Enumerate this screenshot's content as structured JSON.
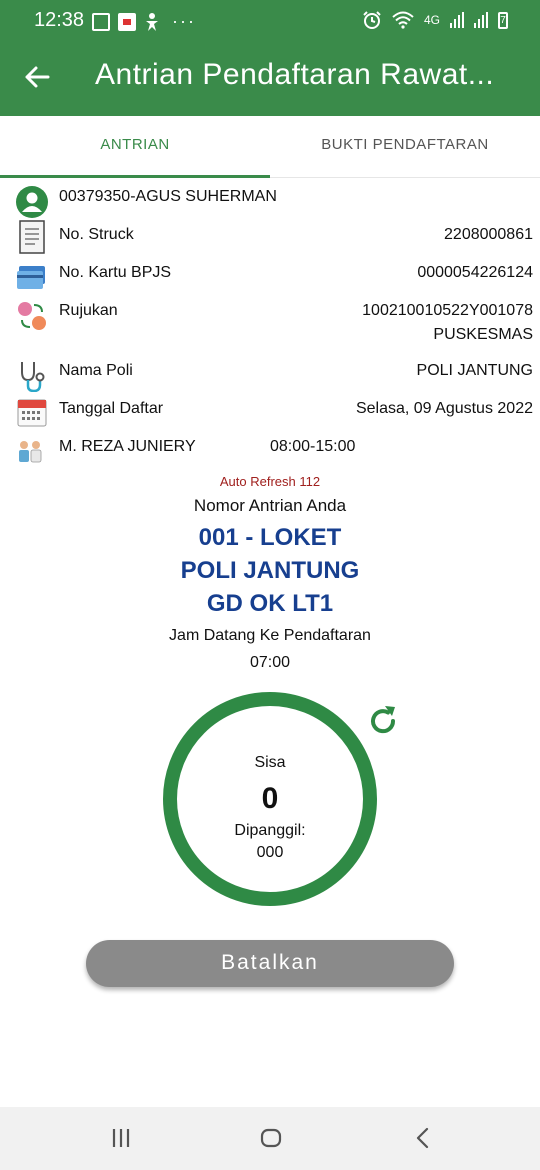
{
  "status_bar": {
    "time": "12:38",
    "network": "4G",
    "battery": "7"
  },
  "app_bar": {
    "title": "Antrian Pendaftaran Rawat..."
  },
  "tabs": [
    {
      "label": "ANTRIAN",
      "active": true
    },
    {
      "label": "BUKTI PENDAFTARAN",
      "active": false
    }
  ],
  "patient": {
    "id_name": "00379350-AGUS SUHERMAN"
  },
  "details": {
    "struck": {
      "label": "No. Struck",
      "value": "2208000861"
    },
    "bpjs": {
      "label": "No. Kartu BPJS",
      "value": "0000054226124"
    },
    "rujukan": {
      "label": "Rujukan",
      "value": "100210010522Y001078",
      "value2": "PUSKESMAS"
    },
    "poli": {
      "label": "Nama Poli",
      "value": "POLI JANTUNG"
    },
    "tanggal": {
      "label": "Tanggal Daftar",
      "value": "Selasa, 09 Agustus 2022"
    },
    "dokter": {
      "name": "M. REZA JUNIERY",
      "hours": "08:00-15:00"
    }
  },
  "queue": {
    "auto_refresh": "Auto Refresh 112",
    "title": "Nomor Antrian Anda",
    "line1": "001 - LOKET",
    "line2": "POLI JANTUNG",
    "line3": "GD OK LT1",
    "jam_label": "Jam Datang Ke Pendaftaran",
    "jam_value": "07:00",
    "sisa_label": "Sisa",
    "sisa_value": "0",
    "dipanggil_label": "Dipanggil:",
    "dipanggil_value": "000"
  },
  "actions": {
    "cancel_label": "Batalkan"
  },
  "colors": {
    "primary": "#3a8b4a",
    "queue_text": "#173f8f",
    "refresh_text": "#a0201e",
    "cancel_bg": "#8a8a8a"
  },
  "icons": {
    "back": "arrow-left-icon",
    "patient": "user-icon",
    "struck": "receipt-icon",
    "bpjs": "card-icon",
    "rujukan": "referral-icon",
    "poli": "stethoscope-icon",
    "tanggal": "calendar-icon",
    "dokter": "doctors-icon",
    "refresh": "refresh-icon"
  }
}
